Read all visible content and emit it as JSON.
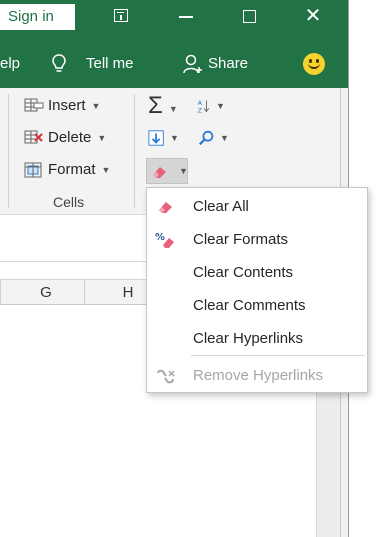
{
  "titlebar": {
    "sign_in": "Sign in",
    "controls": {
      "restore_ribbon": "ribbon-display-options",
      "minimize": "minimize",
      "maximize": "maximize",
      "close": "✕"
    }
  },
  "tabs": {
    "help_partial": "elp",
    "tell_me": "Tell me",
    "share": "Share"
  },
  "ribbon": {
    "insert": "Insert",
    "delete": "Delete",
    "format": "Format",
    "cells_group": "Cells"
  },
  "sheet": {
    "columns": [
      "G",
      "H"
    ]
  },
  "clear_menu": {
    "items": [
      {
        "label": "Clear All",
        "icon": "eraser-icon",
        "enabled": true
      },
      {
        "label": "Clear Formats",
        "icon": "clear-formats-icon",
        "enabled": true
      },
      {
        "label": "Clear Contents",
        "icon": "",
        "enabled": true
      },
      {
        "label": "Clear Comments",
        "icon": "",
        "enabled": true
      },
      {
        "label": "Clear Hyperlinks",
        "icon": "",
        "enabled": true
      },
      {
        "label": "Remove Hyperlinks",
        "icon": "remove-hyperlink-icon",
        "enabled": false
      }
    ]
  },
  "colors": {
    "excel_green": "#217346",
    "ribbon_bg": "#f3f3f3",
    "eraser_pink": "#e8617a",
    "disabled_text": "#a6a6a6"
  }
}
